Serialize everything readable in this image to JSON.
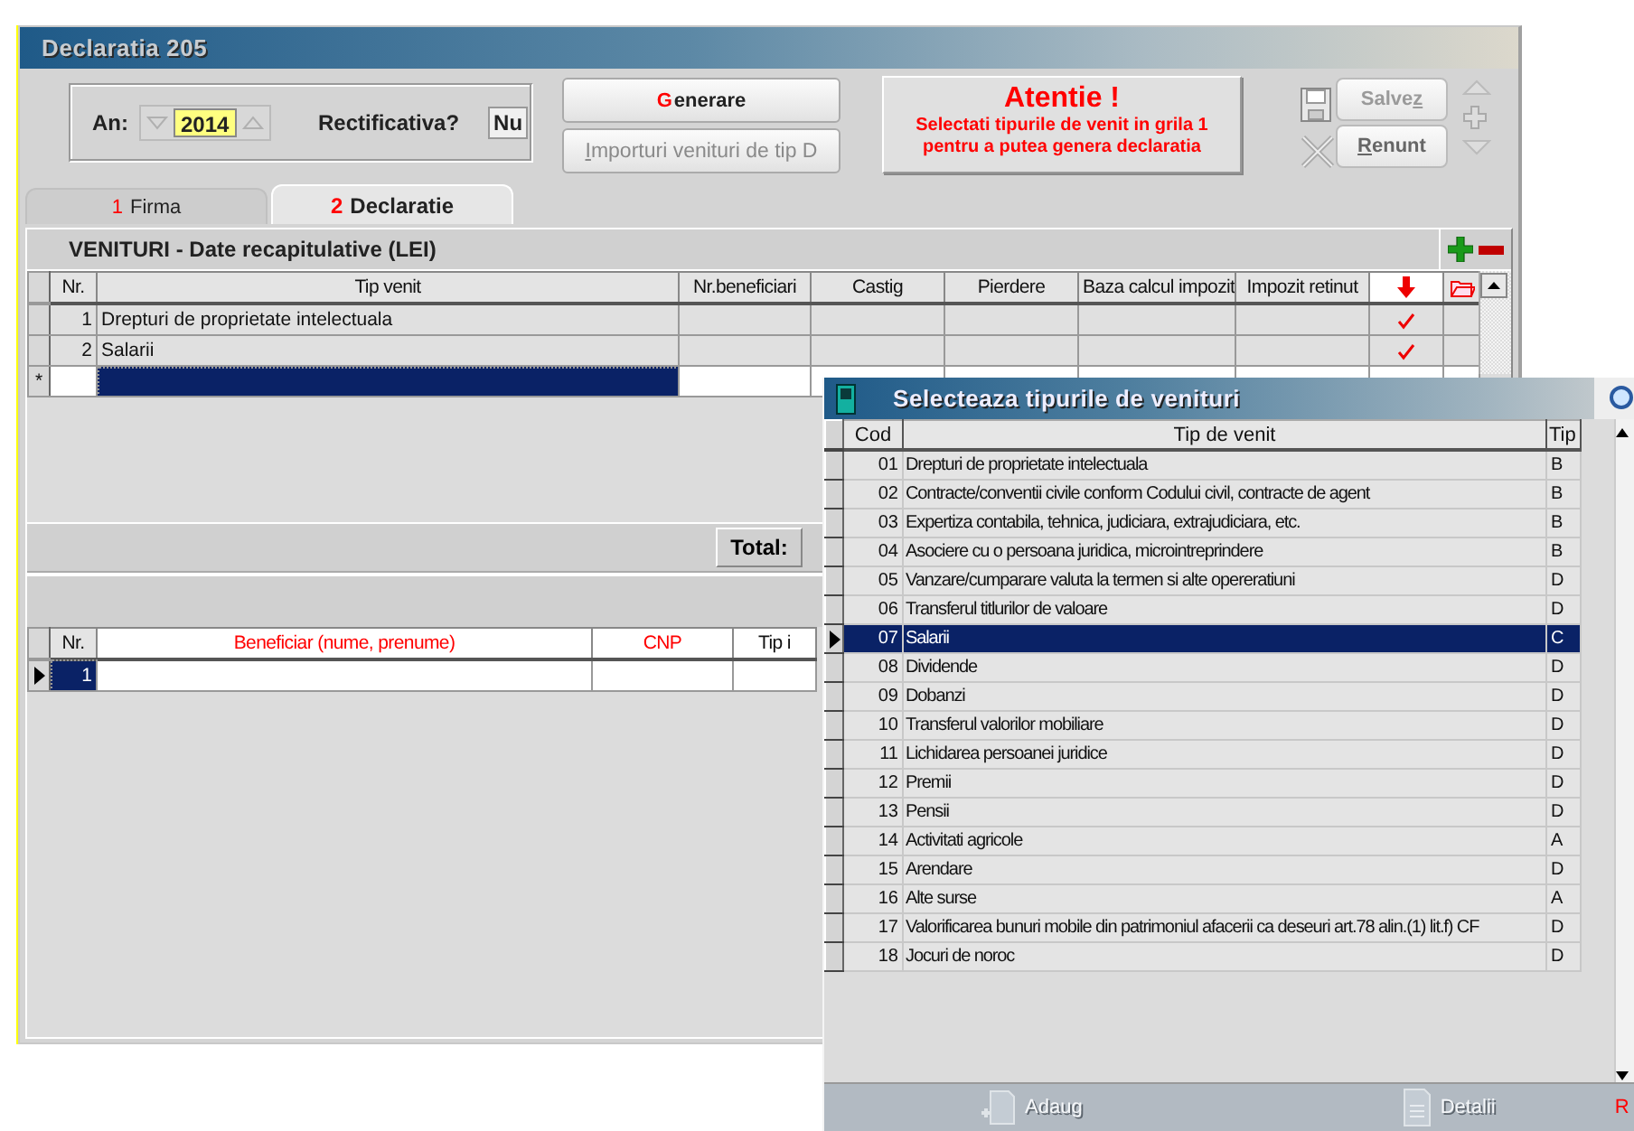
{
  "window": {
    "title": "Declaratia 205"
  },
  "year": {
    "label": "An:",
    "value": "2014"
  },
  "correction": {
    "label": "Rectificativa?",
    "value": "Nu"
  },
  "actions": [
    {
      "key": "G",
      "rest": "enerare",
      "key_red": true,
      "disabled": false
    },
    {
      "key": "I",
      "rest": "mporturi venituri de tip D",
      "key_red": false,
      "disabled": true
    }
  ],
  "warning": {
    "title": "Atentie !",
    "lines": [
      "Selectati tipurile de venit in grila 1",
      "pentru a putea genera declaratia"
    ]
  },
  "edit_buttons": [
    {
      "start": "Salve",
      "key": "z",
      "key_red": false,
      "disabled": true
    },
    {
      "key": "R",
      "rest": "enunt",
      "key_red": false,
      "disabled": false
    }
  ],
  "tabs": [
    {
      "number": "1",
      "label": "Firma",
      "selected": false
    },
    {
      "number": "2",
      "label": "Declaratie",
      "selected": true
    }
  ],
  "income_grid": {
    "title": "VENITURI - Date recapitulative (LEI)",
    "columns": [
      "Nr.",
      "Tip venit",
      "Nr.beneficiari",
      "Castig",
      "Pierdere",
      "Baza calcul impozit",
      "Impozit retinut"
    ],
    "rows": [
      {
        "nr": "1",
        "tip_venit": "Drepturi de proprietate intelectuala",
        "marked": true
      },
      {
        "nr": "2",
        "tip_venit": "Salarii",
        "marked": true
      }
    ],
    "new_row": {
      "marker": "*",
      "selected": true
    }
  },
  "total_label": "Total:",
  "beneficiary_grid": {
    "columns": [
      {
        "label": "Nr.",
        "required": false
      },
      {
        "label": "Beneficiar (nume, prenume)",
        "required": true
      },
      {
        "label": "CNP",
        "required": true
      },
      {
        "label": "Tip i",
        "required": false
      }
    ],
    "rows": [
      {
        "nr": "1",
        "current": true
      }
    ]
  },
  "dialog": {
    "title": "Selecteaza tipurile de venituri",
    "columns": [
      "Cod",
      "Tip de venit",
      "Tip"
    ],
    "rows": [
      {
        "cod": "01",
        "tip_venit": "Drepturi de proprietate intelectuala",
        "tip": "B",
        "selected": false
      },
      {
        "cod": "02",
        "tip_venit": "Contracte/conventii civile conform Codului civil, contracte de agent",
        "tip": "B",
        "selected": false
      },
      {
        "cod": "03",
        "tip_venit": "Expertiza contabila, tehnica, judiciara, extrajudiciara, etc.",
        "tip": "B",
        "selected": false
      },
      {
        "cod": "04",
        "tip_venit": "Asociere cu o persoana juridica, microintreprindere",
        "tip": "B",
        "selected": false
      },
      {
        "cod": "05",
        "tip_venit": "Vanzare/cumparare valuta la termen si alte opereratiuni",
        "tip": "D",
        "selected": false
      },
      {
        "cod": "06",
        "tip_venit": "Transferul titlurilor de valoare",
        "tip": "D",
        "selected": false
      },
      {
        "cod": "07",
        "tip_venit": "Salarii",
        "tip": "C",
        "selected": true
      },
      {
        "cod": "08",
        "tip_venit": "Dividende",
        "tip": "D",
        "selected": false
      },
      {
        "cod": "09",
        "tip_venit": "Dobanzi",
        "tip": "D",
        "selected": false
      },
      {
        "cod": "10",
        "tip_venit": "Transferul valorilor mobiliare",
        "tip": "D",
        "selected": false
      },
      {
        "cod": "11",
        "tip_venit": "Lichidarea persoanei juridice",
        "tip": "D",
        "selected": false
      },
      {
        "cod": "12",
        "tip_venit": "Premii",
        "tip": "D",
        "selected": false
      },
      {
        "cod": "13",
        "tip_venit": "Pensii",
        "tip": "D",
        "selected": false
      },
      {
        "cod": "14",
        "tip_venit": "Activitati agricole",
        "tip": "A",
        "selected": false
      },
      {
        "cod": "15",
        "tip_venit": "Arendare",
        "tip": "D",
        "selected": false
      },
      {
        "cod": "16",
        "tip_venit": "Alte surse",
        "tip": "A",
        "selected": false
      },
      {
        "cod": "17",
        "tip_venit": "Valorificarea bunuri mobile din patrimoniul afacerii ca deseuri art.78 alin.(1) lit.f) CF",
        "tip": "D",
        "selected": false
      },
      {
        "cod": "18",
        "tip_venit": "Jocuri de noroc",
        "tip": "D",
        "selected": false
      }
    ],
    "footer": [
      {
        "kind": "add",
        "label": "Adaug",
        "disabled": true
      },
      {
        "kind": "details",
        "label": "Detalii",
        "disabled": true
      },
      {
        "kind": "text",
        "label": "R",
        "disabled": false
      }
    ]
  }
}
